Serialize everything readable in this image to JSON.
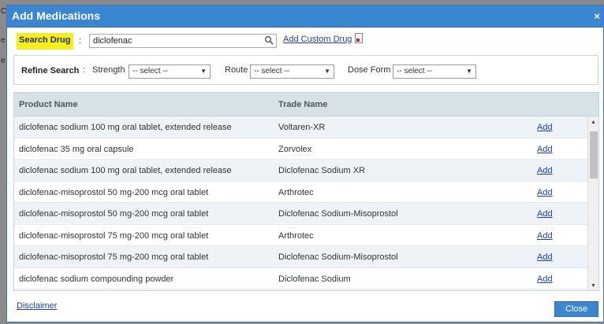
{
  "backdrop": {
    "char_a": "C",
    "char_b": "e",
    "char_c": "e"
  },
  "dialog": {
    "title": "Add Medications",
    "close_glyph": "×"
  },
  "search": {
    "label": "Search Drug",
    "colon": ":",
    "value": "diclofenac",
    "icon": "search-icon",
    "add_custom_label": "Add Custom Drug",
    "add_custom_icon": "document-add-icon"
  },
  "refine": {
    "label": "Refine Search",
    "colon": ":",
    "strength_label": "Strength",
    "strength_value": "-- select --",
    "route_label": "Route",
    "route_value": "-- select --",
    "dose_form_label": "Dose Form",
    "dose_form_value": "-- select --"
  },
  "grid": {
    "columns": [
      "Product Name",
      "Trade Name"
    ],
    "rows": [
      {
        "product": "diclofenac sodium 100 mg oral tablet, extended release",
        "trade": "Voltaren-XR",
        "action": "Add"
      },
      {
        "product": "diclofenac 35 mg oral capsule",
        "trade": "Zorvolex",
        "action": "Add"
      },
      {
        "product": "diclofenac sodium 100 mg oral tablet, extended release",
        "trade": "Diclofenac Sodium XR",
        "action": "Add"
      },
      {
        "product": "diclofenac-misoprostol 50 mg-200 mcg oral tablet",
        "trade": "Arthrotec",
        "action": "Add"
      },
      {
        "product": "diclofenac-misoprostol 50 mg-200 mcg oral tablet",
        "trade": "Diclofenac Sodium-Misoprostol",
        "action": "Add"
      },
      {
        "product": "diclofenac-misoprostol 75 mg-200 mcg oral tablet",
        "trade": "Arthrotec",
        "action": "Add"
      },
      {
        "product": "diclofenac-misoprostol 75 mg-200 mcg oral tablet",
        "trade": "Diclofenac Sodium-Misoprostol",
        "action": "Add"
      },
      {
        "product": "diclofenac sodium compounding powder",
        "trade": "Diclofenac Sodium",
        "action": "Add"
      }
    ]
  },
  "footer": {
    "disclaimer": "Disclaimer",
    "close_label": "Close"
  },
  "colors": {
    "title_bar": "#3a86d0",
    "search_highlight": "#f4ef1c",
    "link": "#1c3fb5",
    "header_bg": "#d6e1e8"
  }
}
